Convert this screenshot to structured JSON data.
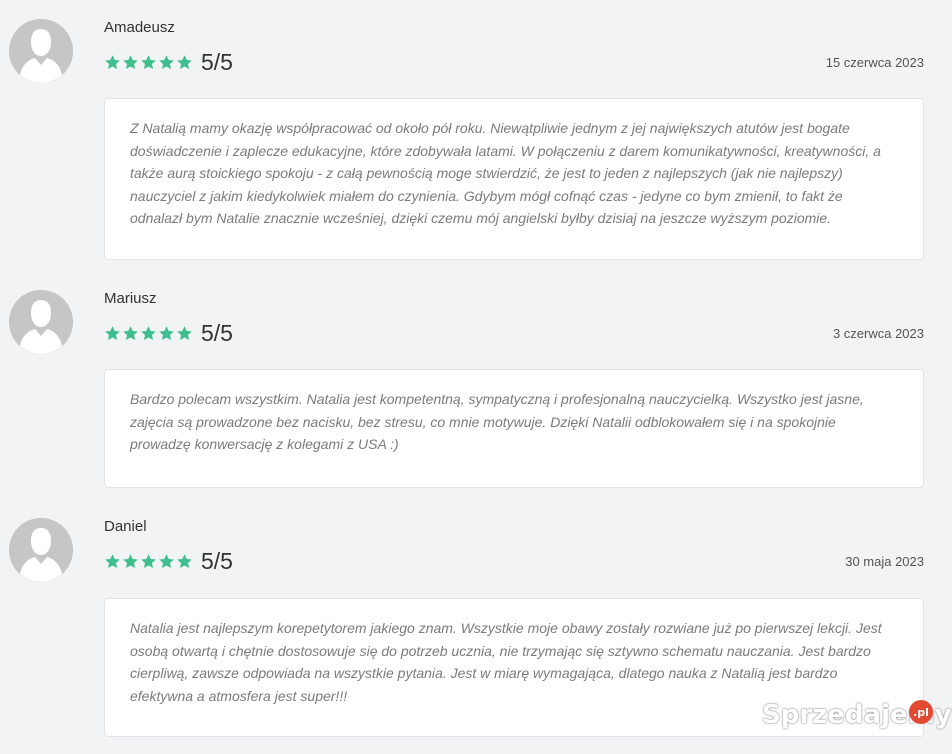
{
  "reviews": [
    {
      "name": "Amadeusz",
      "score": "5/5",
      "stars": 5,
      "date": "15 czerwca 2023",
      "text": "Z Natalią mamy okazję współpracować od około pół roku. Niewątpliwie jednym z jej największych atutów jest bogate doświadczenie i zaplecze edukacyjne, które zdobywała latami. W połączeniu z darem komunikatywności, kreatywności, a także aurą stoickiego spokoju - z całą pewnością moge stwierdzić, że jest to jeden z najlepszych (jak nie najlepszy) nauczyciel z jakim kiedykolwiek miałem do czynienia. Gdybym mógł cofnąć czas - jedyne co bym zmienił, to fakt że odnalazł bym Natalie znacznie wcześniej, dzięki czemu mój angielski byłby dzisiaj na jeszcze wyższym poziomie."
    },
    {
      "name": "Mariusz",
      "score": "5/5",
      "stars": 5,
      "date": "3 czerwca 2023",
      "text": "Bardzo polecam wszystkim. Natalia jest kompetentną, sympatyczną i profesjonalną nauczycielką. Wszystko jest jasne, zajęcia są prowadzone bez nacisku, bez stresu, co mnie motywuje. Dzięki Natalii odblokowałem się i na spokojnie prowadzę konwersację z kolegami z USA :)"
    },
    {
      "name": "Daniel",
      "score": "5/5",
      "stars": 5,
      "date": "30 maja 2023",
      "text": "Natalia jest najlepszym korepetytorem jakiego znam. Wszystkie moje obawy zostały rozwiane już po pierwszej lekcji. Jest osobą otwartą i chętnie dostosowuje się do potrzeb ucznia, nie trzymając się sztywno schematu nauczania. Jest bardzo cierpliwą, zawsze odpowiada na wszystkie pytania. Jest w miarę wymagająca, dlatego nauka z Natalią jest bardzo efektywna a atmosfera jest super!!!"
    }
  ],
  "watermark": {
    "text": "Sprzedajemy",
    "badge": ".pl"
  },
  "colors": {
    "star": "#3dbf8e",
    "avatar_bg": "#c6c6c6",
    "page_bg": "#f2f3f5"
  },
  "icons": {
    "avatar": "user-silhouette-icon",
    "star": "star-icon"
  }
}
